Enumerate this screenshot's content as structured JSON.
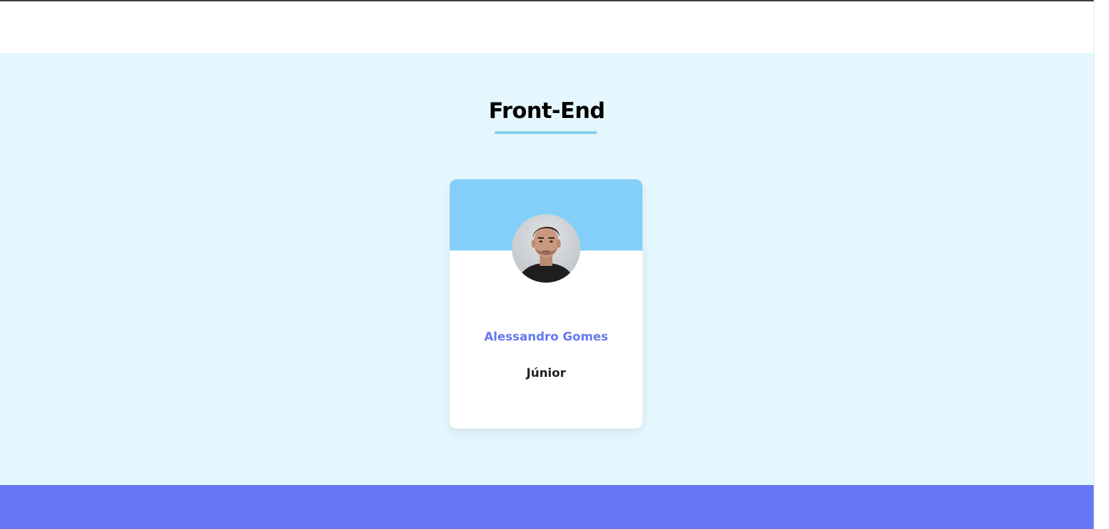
{
  "section": {
    "title": "Front-End"
  },
  "team_card": {
    "name": "Alessandro Gomes",
    "level": "Júnior",
    "avatar_icon": "profile-photo"
  },
  "colors": {
    "section_bg": "#e5f7fe",
    "card_header": "#84cffa",
    "name_accent": "#6479f0",
    "footer_band": "#6576f5",
    "title_underline": "#86d0ea"
  }
}
